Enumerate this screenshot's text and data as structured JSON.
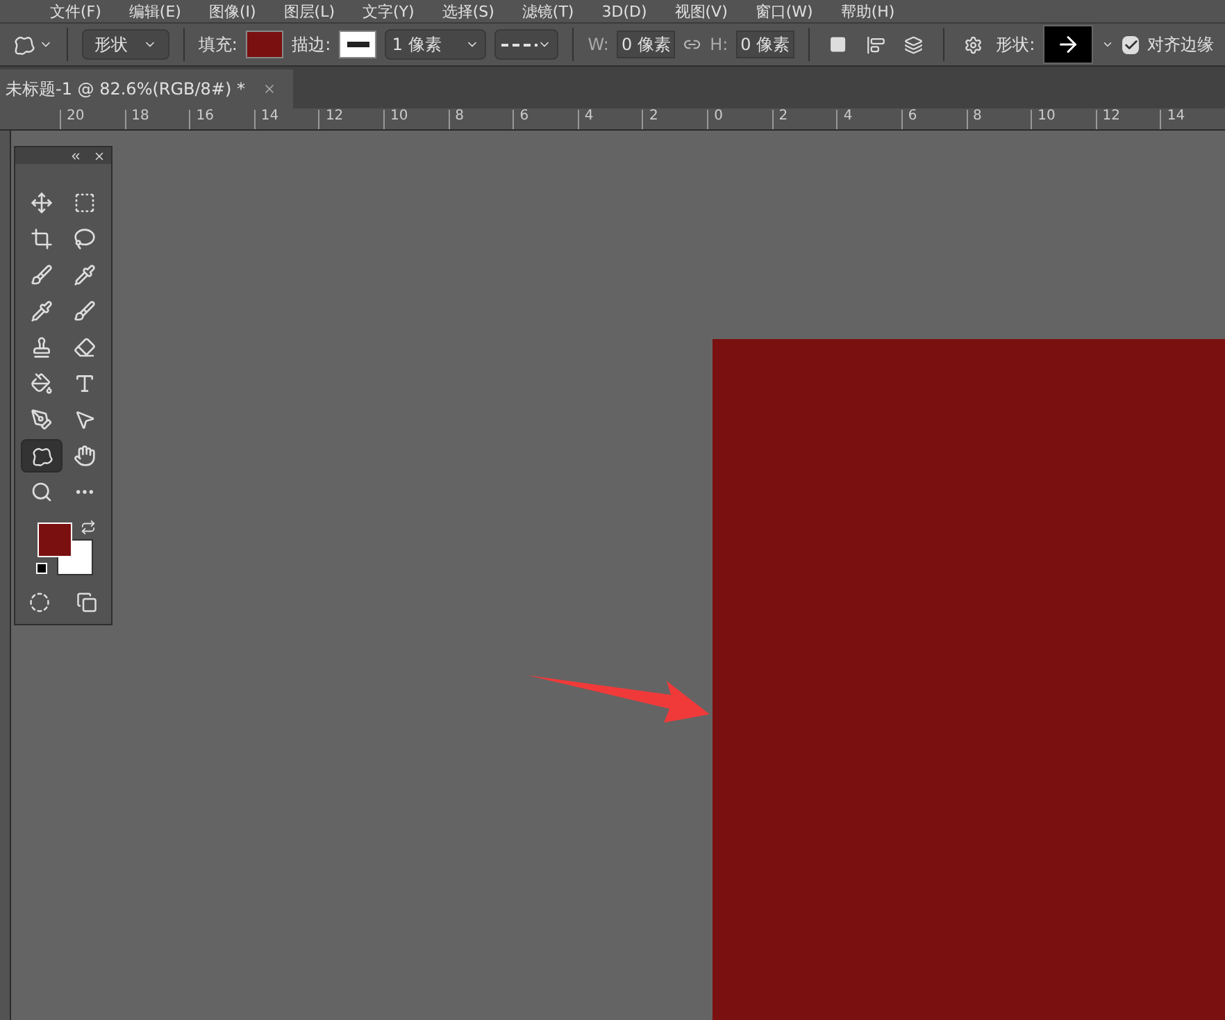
{
  "menu": [
    "文件(F)",
    "编辑(E)",
    "图像(I)",
    "图层(L)",
    "文字(Y)",
    "选择(S)",
    "滤镜(T)",
    "3D(D)",
    "视图(V)",
    "窗口(W)",
    "帮助(H)"
  ],
  "options_bar": {
    "mode": "形状",
    "fill_label": "填充:",
    "stroke_label": "描边:",
    "stroke_width": "1 像素",
    "w_label": "W:",
    "w_value": "0 像素",
    "h_label": "H:",
    "h_value": "0 像素",
    "shape_label": "形状:",
    "align_edges": {
      "label": "对齐边缘",
      "checked": true
    }
  },
  "document_tab": {
    "title": "未标题-1 @ 82.6%(RGB/8#) *"
  },
  "ruler_labels": [
    "20",
    "18",
    "16",
    "14",
    "12",
    "10",
    "8",
    "6",
    "4",
    "2",
    "0",
    "2",
    "4",
    "6",
    "8",
    "10",
    "12",
    "14"
  ],
  "tools": [
    {
      "kind": "move",
      "selected": false
    },
    {
      "kind": "marquee",
      "selected": false
    },
    {
      "kind": "crop",
      "selected": false
    },
    {
      "kind": "lasso",
      "selected": false
    },
    {
      "kind": "quick-select",
      "selected": false
    },
    {
      "kind": "eyedropper-alt",
      "selected": false
    },
    {
      "kind": "eyedropper",
      "selected": false
    },
    {
      "kind": "brush",
      "selected": false
    },
    {
      "kind": "stamp",
      "selected": false
    },
    {
      "kind": "eraser",
      "selected": false
    },
    {
      "kind": "bucket",
      "selected": false
    },
    {
      "kind": "type",
      "selected": false
    },
    {
      "kind": "pen",
      "selected": false
    },
    {
      "kind": "pointer",
      "selected": false
    },
    {
      "kind": "shape",
      "selected": true
    },
    {
      "kind": "hand",
      "selected": false
    },
    {
      "kind": "zoom",
      "selected": false
    },
    {
      "kind": "more",
      "selected": false
    }
  ]
}
